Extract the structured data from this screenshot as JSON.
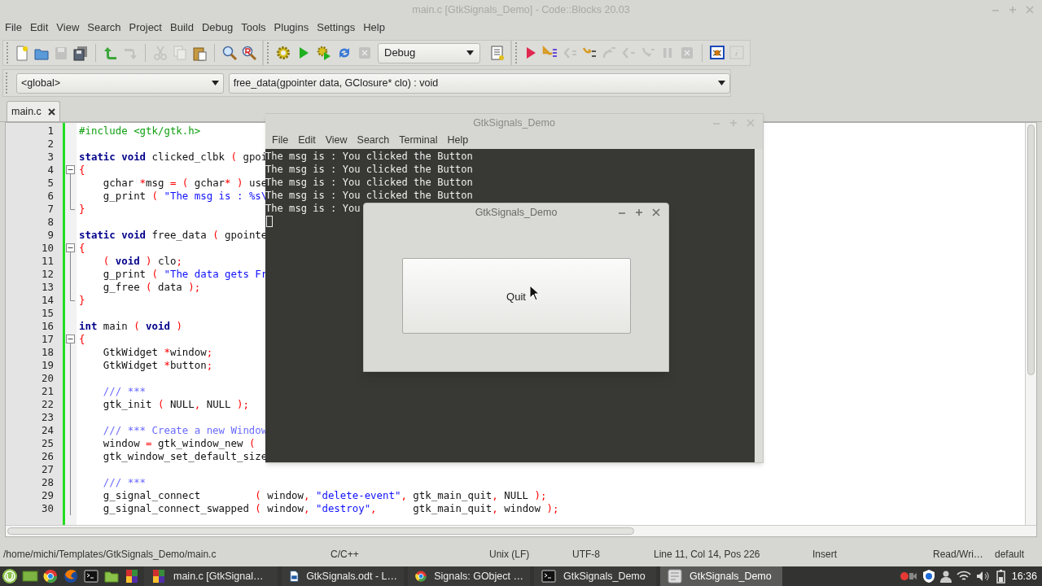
{
  "window": {
    "title": "main.c [GtkSignals_Demo] - Code::Blocks 20.03"
  },
  "menu": [
    "File",
    "Edit",
    "View",
    "Search",
    "Project",
    "Build",
    "Debug",
    "Tools",
    "Plugins",
    "Settings",
    "Help"
  ],
  "main_toolbar": [
    [
      {
        "kind": "new",
        "disabled": false
      },
      {
        "kind": "open",
        "disabled": false
      },
      {
        "kind": "save",
        "disabled": true
      },
      {
        "kind": "save_all",
        "disabled": false
      }
    ],
    [
      {
        "kind": "undo",
        "disabled": false
      },
      {
        "kind": "redo",
        "disabled": true
      }
    ],
    [
      {
        "kind": "cut",
        "disabled": true
      },
      {
        "kind": "copy",
        "disabled": true
      },
      {
        "kind": "paste",
        "disabled": false
      }
    ],
    [
      {
        "kind": "find",
        "disabled": false
      },
      {
        "kind": "replace",
        "disabled": false
      }
    ]
  ],
  "compiler_toolbar": {
    "buttons": [
      {
        "kind": "build",
        "disabled": false
      },
      {
        "kind": "run",
        "disabled": false
      },
      {
        "kind": "build_run",
        "disabled": false
      },
      {
        "kind": "rebuild",
        "disabled": false
      },
      {
        "kind": "abort",
        "disabled": true
      }
    ],
    "target": "Debug",
    "extras": [
      {
        "kind": "build_log",
        "disabled": false
      }
    ]
  },
  "debugger_toolbar": [
    [
      {
        "kind": "debug",
        "disabled": false
      },
      {
        "kind": "run_to_cursor",
        "disabled": false
      },
      {
        "kind": "next_line",
        "disabled": true
      },
      {
        "kind": "step_into",
        "disabled": false
      },
      {
        "kind": "step_out",
        "disabled": true
      },
      {
        "kind": "next_instruction",
        "disabled": true
      },
      {
        "kind": "step_instruction",
        "disabled": true
      },
      {
        "kind": "pause",
        "disabled": true
      },
      {
        "kind": "stop",
        "disabled": true
      }
    ],
    [
      {
        "kind": "debug_windows",
        "disabled": false
      },
      {
        "kind": "info",
        "disabled": true
      }
    ]
  ],
  "scope": {
    "value": "<global>"
  },
  "function": {
    "value": "free_data(gpointer data, GClosure* clo) : void"
  },
  "tabs": [
    {
      "label": "main.c",
      "selected": true
    }
  ],
  "editor": {
    "lines": [
      {
        "number": "1",
        "kind": "plain",
        "segments": [
          {
            "kind": "preprocessor",
            "text": "#include <gtk/gtk.h>"
          }
        ]
      },
      {
        "number": "2",
        "kind": "plain"
      },
      {
        "number": "3",
        "kind": "plain",
        "segments": [
          {
            "kind": "keyword",
            "text": "static void"
          },
          {
            "kind": "plain",
            "text": " clicked_clbk "
          },
          {
            "kind": "operator",
            "text": "("
          },
          {
            "kind": "plain",
            "text": " gpoi"
          }
        ]
      },
      {
        "number": "4",
        "kind": "start",
        "segments": [
          {
            "kind": "operator",
            "text": "{"
          }
        ]
      },
      {
        "number": "5",
        "kind": "body",
        "segments": [
          {
            "kind": "plain",
            "text": "    gchar "
          },
          {
            "kind": "operator",
            "text": "*"
          },
          {
            "kind": "plain",
            "text": "msg "
          },
          {
            "kind": "operator",
            "text": "= ("
          },
          {
            "kind": "plain",
            "text": " gchar"
          },
          {
            "kind": "operator",
            "text": "* )"
          },
          {
            "kind": "plain",
            "text": " use"
          }
        ]
      },
      {
        "number": "6",
        "kind": "body",
        "segments": [
          {
            "kind": "plain",
            "text": "    g_print "
          },
          {
            "kind": "operator",
            "text": "("
          },
          {
            "kind": "string",
            "text": " \"The msg is : %s\\"
          }
        ]
      },
      {
        "number": "7",
        "kind": "end",
        "segments": [
          {
            "kind": "operator",
            "text": "}"
          }
        ]
      },
      {
        "number": "8",
        "kind": "plain"
      },
      {
        "number": "9",
        "kind": "plain",
        "segments": [
          {
            "kind": "keyword",
            "text": "static void"
          },
          {
            "kind": "plain",
            "text": " free_data "
          },
          {
            "kind": "operator",
            "text": "("
          },
          {
            "kind": "plain",
            "text": " gpointe"
          }
        ]
      },
      {
        "number": "10",
        "kind": "start",
        "segments": [
          {
            "kind": "operator",
            "text": "{"
          }
        ]
      },
      {
        "number": "11",
        "kind": "body",
        "segments": [
          {
            "kind": "operator",
            "text": "    ("
          },
          {
            "kind": "keyword",
            "text": " void"
          },
          {
            "kind": "operator",
            "text": " )"
          },
          {
            "kind": "plain",
            "text": " clo"
          },
          {
            "kind": "operator",
            "text": ";"
          }
        ]
      },
      {
        "number": "12",
        "kind": "body",
        "segments": [
          {
            "kind": "plain",
            "text": "    g_print "
          },
          {
            "kind": "operator",
            "text": "("
          },
          {
            "kind": "string",
            "text": " \"The data gets Fr"
          }
        ]
      },
      {
        "number": "13",
        "kind": "body",
        "segments": [
          {
            "kind": "plain",
            "text": "    g_free "
          },
          {
            "kind": "operator",
            "text": "("
          },
          {
            "kind": "plain",
            "text": " data "
          },
          {
            "kind": "operator",
            "text": ");"
          }
        ]
      },
      {
        "number": "14",
        "kind": "end",
        "segments": [
          {
            "kind": "operator",
            "text": "}"
          }
        ]
      },
      {
        "number": "15",
        "kind": "plain"
      },
      {
        "number": "16",
        "kind": "plain",
        "segments": [
          {
            "kind": "keyword",
            "text": "int"
          },
          {
            "kind": "plain",
            "text": " main "
          },
          {
            "kind": "operator",
            "text": "("
          },
          {
            "kind": "keyword",
            "text": " void"
          },
          {
            "kind": "operator",
            "text": " )"
          }
        ]
      },
      {
        "number": "17",
        "kind": "start",
        "segments": [
          {
            "kind": "operator",
            "text": "{"
          }
        ]
      },
      {
        "number": "18",
        "kind": "body",
        "segments": [
          {
            "kind": "plain",
            "text": "    GtkWidget "
          },
          {
            "kind": "operator",
            "text": "*"
          },
          {
            "kind": "plain",
            "text": "window"
          },
          {
            "kind": "operator",
            "text": ";"
          }
        ]
      },
      {
        "number": "19",
        "kind": "body",
        "segments": [
          {
            "kind": "plain",
            "text": "    GtkWidget "
          },
          {
            "kind": "operator",
            "text": "*"
          },
          {
            "kind": "plain",
            "text": "button"
          },
          {
            "kind": "operator",
            "text": ";"
          }
        ]
      },
      {
        "number": "20",
        "kind": "body"
      },
      {
        "number": "21",
        "kind": "body",
        "segments": [
          {
            "kind": "comment",
            "text": "    /// ***"
          }
        ]
      },
      {
        "number": "22",
        "kind": "body",
        "segments": [
          {
            "kind": "plain",
            "text": "    gtk_init "
          },
          {
            "kind": "operator",
            "text": "("
          },
          {
            "kind": "plain",
            "text": " NULL"
          },
          {
            "kind": "operator",
            "text": ","
          },
          {
            "kind": "plain",
            "text": " NULL "
          },
          {
            "kind": "operator",
            "text": ");"
          }
        ]
      },
      {
        "number": "23",
        "kind": "body"
      },
      {
        "number": "24",
        "kind": "body",
        "segments": [
          {
            "kind": "comment",
            "text": "    /// *** Create a new Window"
          }
        ]
      },
      {
        "number": "25",
        "kind": "body",
        "segments": [
          {
            "kind": "plain",
            "text": "    window "
          },
          {
            "kind": "operator",
            "text": "="
          },
          {
            "kind": "plain",
            "text": " gtk_window_new "
          },
          {
            "kind": "operator",
            "text": "("
          }
        ]
      },
      {
        "number": "26",
        "kind": "body",
        "segments": [
          {
            "kind": "plain",
            "text": "    gtk_window_set_default_size"
          }
        ]
      },
      {
        "number": "27",
        "kind": "body"
      },
      {
        "number": "28",
        "kind": "body",
        "segments": [
          {
            "kind": "comment",
            "text": "    /// ***"
          }
        ]
      },
      {
        "number": "29",
        "kind": "body",
        "segments": [
          {
            "kind": "plain",
            "text": "    g_signal_connect         "
          },
          {
            "kind": "operator",
            "text": "("
          },
          {
            "kind": "plain",
            "text": " window"
          },
          {
            "kind": "operator",
            "text": ","
          },
          {
            "kind": "string",
            "text": " \"delete-event\""
          },
          {
            "kind": "operator",
            "text": ","
          },
          {
            "kind": "plain",
            "text": " gtk_main_quit"
          },
          {
            "kind": "operator",
            "text": ","
          },
          {
            "kind": "plain",
            "text": " NULL "
          },
          {
            "kind": "operator",
            "text": ");"
          }
        ]
      },
      {
        "number": "30",
        "kind": "body",
        "segments": [
          {
            "kind": "plain",
            "text": "    g_signal_connect_swapped "
          },
          {
            "kind": "operator",
            "text": "("
          },
          {
            "kind": "plain",
            "text": " window"
          },
          {
            "kind": "operator",
            "text": ","
          },
          {
            "kind": "string",
            "text": " \"destroy\""
          },
          {
            "kind": "operator",
            "text": ","
          },
          {
            "kind": "plain",
            "text": "      gtk_main_quit"
          },
          {
            "kind": "operator",
            "text": ","
          },
          {
            "kind": "plain",
            "text": " window "
          },
          {
            "kind": "operator",
            "text": ");"
          }
        ]
      }
    ]
  },
  "terminal": {
    "title": "GtkSignals_Demo",
    "menu": [
      "File",
      "Edit",
      "View",
      "Search",
      "Terminal",
      "Help"
    ],
    "lines": [
      "The msg is : You clicked the Button",
      "The msg is : You clicked the Button",
      "The msg is : You clicked the Button",
      "The msg is : You clicked the Button",
      "The msg is : You"
    ]
  },
  "dialog": {
    "title": "GtkSignals_Demo",
    "button": "Quit"
  },
  "status_bar": [
    "/home/michi/Templates/GtkSignals_Demo/main.c",
    "C/C++",
    "Unix (LF)",
    "UTF-8",
    "Line 11, Col 14, Pos 226",
    "Insert",
    "Read/Wri…",
    "default"
  ],
  "taskbar": {
    "tasks": [
      {
        "kind": "ide",
        "label": "main.c [GtkSignal…",
        "selected": false
      },
      {
        "kind": "document",
        "label": "GtkSignals.odt - L…",
        "selected": false
      },
      {
        "kind": "browser",
        "label": "Signals: GObject …",
        "selected": false
      },
      {
        "kind": "terminal",
        "label": "GtkSignals_Demo",
        "selected": false
      },
      {
        "kind": "app",
        "label": "GtkSignals_Demo",
        "selected": true
      }
    ],
    "clock": "16:36"
  }
}
